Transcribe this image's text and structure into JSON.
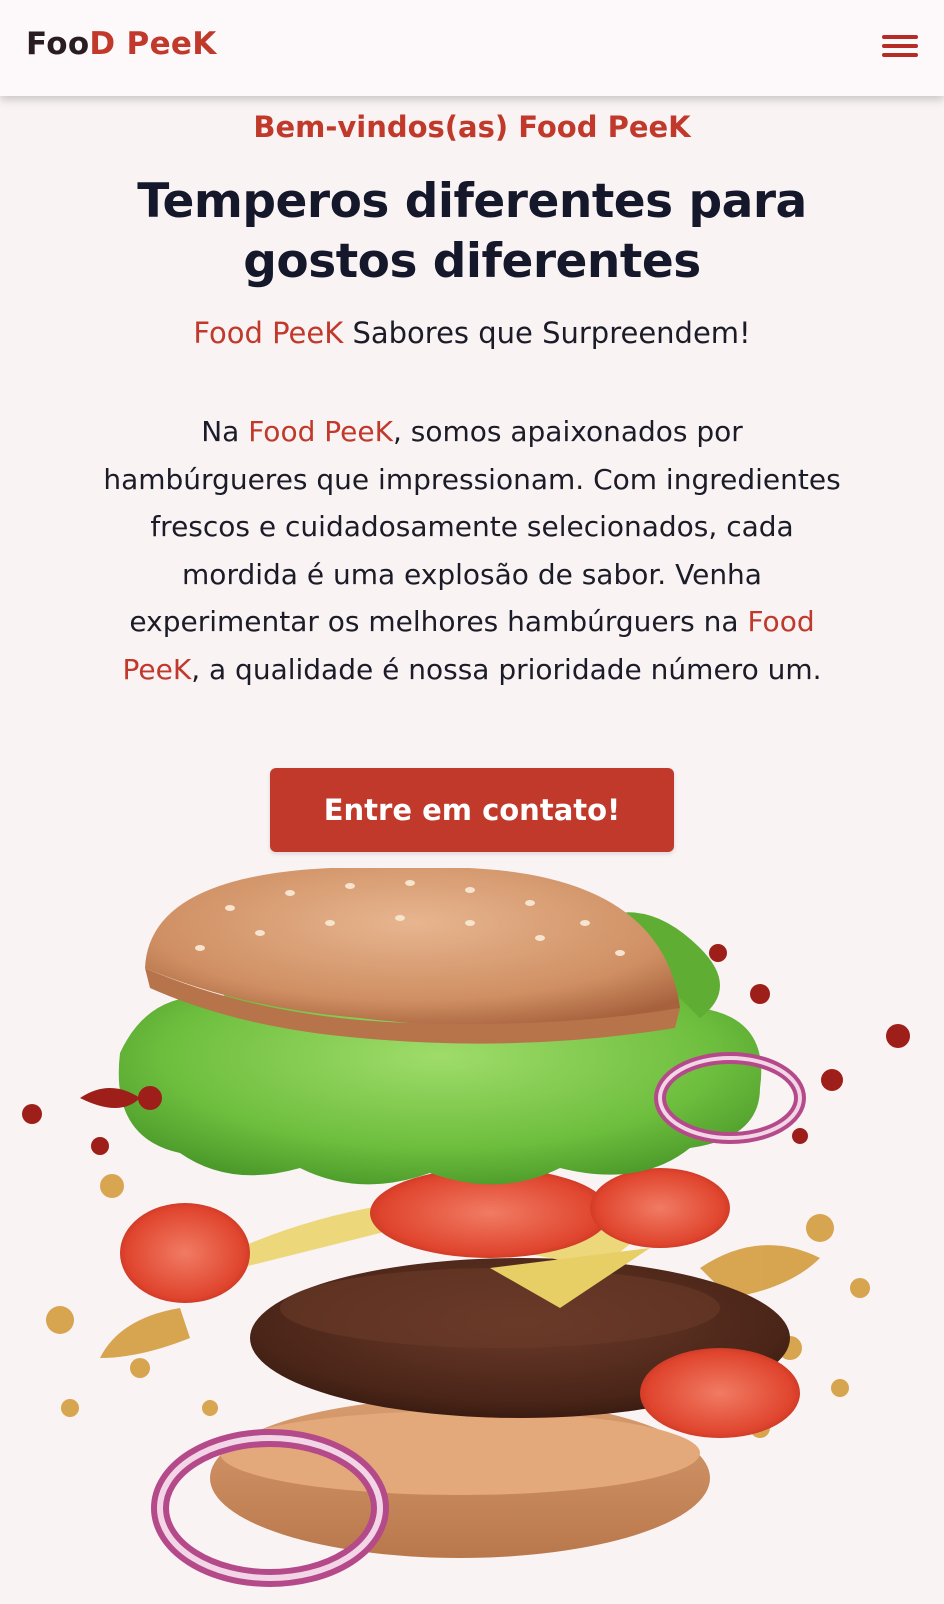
{
  "header": {
    "logo_part1": "Foo",
    "logo_part2": "D",
    "logo_part3": " Pee",
    "logo_part4": "K",
    "menu_icon": "hamburger-menu-icon"
  },
  "hero": {
    "subtitle": "Bem-vindos(as) Food PeeK",
    "headline": "Temperos diferentes para gostos diferentes",
    "tagline_brand": "Food PeeK",
    "tagline_rest": " Sabores que Surpreendem!",
    "desc_part1": "Na ",
    "desc_brand1": "Food PeeK",
    "desc_part2": ", somos apaixonados por hambúrgueres que impressionam. Com ingredientes frescos e cuidadosamente selecionados, cada mordida é uma explosão de sabor. Venha experimentar os melhores hambúrguers na ",
    "desc_brand2": "Food PeeK",
    "desc_part3": ", a qualidade é nossa prioridade número um.",
    "cta_label": "Entre em contato!",
    "image": "hamburger-photo"
  },
  "colors": {
    "accent": "#c0392b",
    "text": "#15172a",
    "background": "#f9f3f4"
  }
}
